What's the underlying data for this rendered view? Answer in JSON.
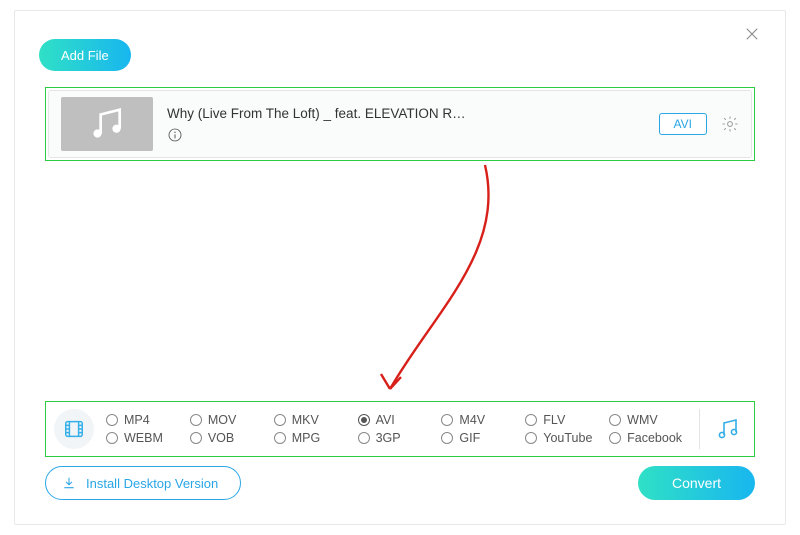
{
  "header": {
    "add_file_label": "Add File"
  },
  "file": {
    "title": "Why (Live From The Loft) _ feat. ELEVATION R…",
    "format_badge": "AVI"
  },
  "formats": {
    "row1": [
      "MP4",
      "MOV",
      "MKV",
      "AVI",
      "M4V",
      "FLV",
      "WMV"
    ],
    "row2": [
      "WEBM",
      "VOB",
      "MPG",
      "3GP",
      "GIF",
      "YouTube",
      "Facebook"
    ],
    "selected": "AVI"
  },
  "footer": {
    "install_label": "Install Desktop Version",
    "convert_label": "Convert"
  }
}
